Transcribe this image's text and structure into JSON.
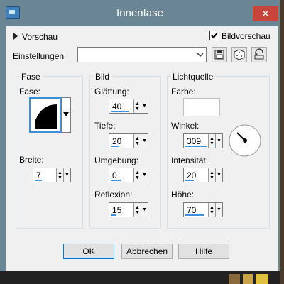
{
  "window": {
    "title": "Innenfase",
    "close_glyph": "✕"
  },
  "preview": {
    "label": "Vorschau",
    "toggle_icon": "triangle-right-icon"
  },
  "bildvorschau": {
    "label": "Bildvorschau",
    "checked": true
  },
  "einstellungen": {
    "label": "Einstellungen",
    "value": ""
  },
  "fase_group": {
    "title": "Fase",
    "fase_label": "Fase:",
    "breite_label": "Breite:",
    "breite_value": "7"
  },
  "bild_group": {
    "title": "Bild",
    "glaettung_label": "Glättung:",
    "glaettung_value": "40",
    "tiefe_label": "Tiefe:",
    "tiefe_value": "20",
    "umgebung_label": "Umgebung:",
    "umgebung_value": "0",
    "reflexion_label": "Reflexion:",
    "reflexion_value": "15"
  },
  "licht_group": {
    "title": "Lichtquelle",
    "farbe_label": "Farbe:",
    "farbe_color": "#ffffff",
    "winkel_label": "Winkel:",
    "winkel_value": "309",
    "intensitaet_label": "Intensität:",
    "intensitaet_value": "20",
    "hoehe_label": "Höhe:",
    "hoehe_value": "70"
  },
  "buttons": {
    "ok": "OK",
    "abbrechen": "Abbrechen",
    "hilfe": "Hilfe"
  },
  "colors": {
    "titlebar": "#6a8593",
    "close": "#c8453c",
    "accent": "#3c8fdd",
    "dialog": "#f0f0f0"
  }
}
